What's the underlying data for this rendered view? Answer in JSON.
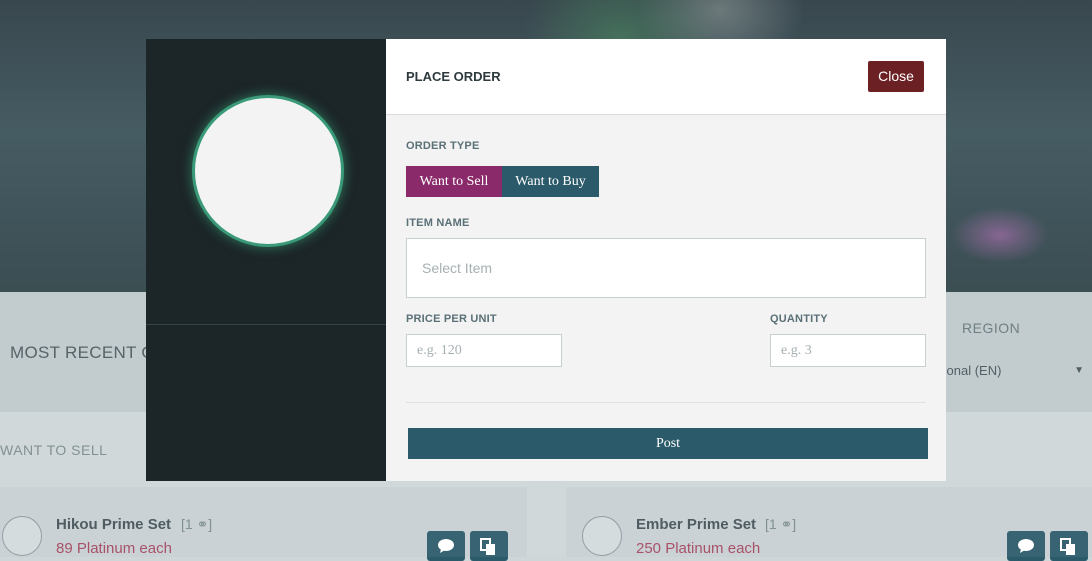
{
  "background": {
    "section_title": "MOST RECENT O",
    "region_label": "REGION",
    "region_value": "tional (EN)",
    "want_to_sell_label": "WANT TO SELL",
    "listings": [
      {
        "name": "Hikou Prime Set",
        "count": "[1 ⚭]",
        "price": "89 Platinum each"
      },
      {
        "name": "Ember Prime Set",
        "count": "[1 ⚭]",
        "price": "250 Platinum each"
      }
    ]
  },
  "modal": {
    "title": "PLACE ORDER",
    "close_label": "Close",
    "order_type_label": "ORDER TYPE",
    "order_types": [
      "Want to Sell",
      "Want to Buy"
    ],
    "item_name_label": "ITEM NAME",
    "item_placeholder": "Select Item",
    "price_label": "PRICE PER UNIT",
    "price_placeholder": "e.g. 120",
    "quantity_label": "QUANTITY",
    "quantity_placeholder": "e.g. 3",
    "post_label": "Post"
  },
  "colors": {
    "sell_toggle": "#8a2a6a",
    "buy_toggle": "#2b5a6a",
    "close_button": "#6b2023",
    "post_button": "#2b5a6a",
    "avatar_ring": "#3a9a78"
  }
}
